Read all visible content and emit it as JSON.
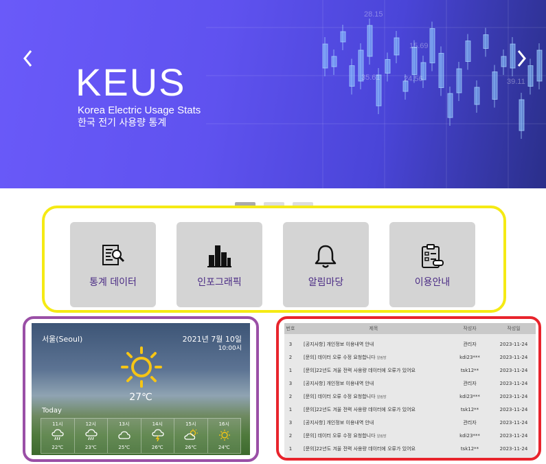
{
  "hero": {
    "title": "KEUS",
    "subtitle_en": "Korea Electric Usage Stats",
    "subtitle_ko": "한국 전기 사용량 통계",
    "bg_numbers": [
      "28.15",
      "24.56",
      "39.11",
      "15.69",
      "35.61"
    ]
  },
  "carousel": {
    "prev_icon": "chevron-left-icon",
    "next_icon": "chevron-right-icon",
    "page_count": 3,
    "active_page": 1
  },
  "quick_menu": {
    "items": [
      {
        "label": "통계 데이터",
        "icon": "document-search-icon"
      },
      {
        "label": "인포그래픽",
        "icon": "bar-chart-icon"
      },
      {
        "label": "알림마당",
        "icon": "bell-icon"
      },
      {
        "label": "이용안내",
        "icon": "clipboard-icon"
      }
    ]
  },
  "weather": {
    "city": "서울(Seoul)",
    "date": "2021년 7월 10일",
    "time": "10:00시",
    "current_temp": "27℃",
    "current_icon": "sun-icon",
    "today_label": "Today",
    "hourly": [
      {
        "hour": "11시",
        "icon": "rain-cloud-icon",
        "temp": "22℃"
      },
      {
        "hour": "12시",
        "icon": "rain-cloud-icon",
        "temp": "23℃"
      },
      {
        "hour": "13시",
        "icon": "cloud-icon",
        "temp": "25℃"
      },
      {
        "hour": "14시",
        "icon": "thunder-cloud-icon",
        "temp": "26℃"
      },
      {
        "hour": "15시",
        "icon": "partly-sunny-icon",
        "temp": "26℃"
      },
      {
        "hour": "16시",
        "icon": "sun-icon",
        "temp": "24℃"
      }
    ]
  },
  "board": {
    "headers": {
      "no": "번호",
      "title": "제목",
      "writer": "작성자",
      "date": "작성일"
    },
    "new_badge": "알림방",
    "rows": [
      {
        "no": "3",
        "title": "[공지사항] 개인정보 이용내역 안내",
        "new": false,
        "writer": "관리자",
        "date": "2023-11-24"
      },
      {
        "no": "2",
        "title": "[문의] 데이터 오류 수정 요청합니다",
        "new": true,
        "writer": "kdi23***",
        "date": "2023-11-24"
      },
      {
        "no": "1",
        "title": "[문의]22년도 겨울 전력 사용량 데이터에 오류가 있어요",
        "new": false,
        "writer": "tsk12**",
        "date": "2023-11-24"
      },
      {
        "no": "3",
        "title": "[공지사항] 개인정보 이용내역 안내",
        "new": false,
        "writer": "관리자",
        "date": "2023-11-24"
      },
      {
        "no": "2",
        "title": "[문의] 데이터 오류 수정 요청합니다",
        "new": true,
        "writer": "kdi23***",
        "date": "2023-11-24"
      },
      {
        "no": "1",
        "title": "[문의]22년도 겨울 전력 사용량 데이터에 오류가 있어요",
        "new": false,
        "writer": "tsk12**",
        "date": "2023-11-24"
      },
      {
        "no": "3",
        "title": "[공지사항] 개인정보 이용내역 안내",
        "new": false,
        "writer": "관리자",
        "date": "2023-11-24"
      },
      {
        "no": "2",
        "title": "[문의] 데이터 오류 수정 요청합니다",
        "new": true,
        "writer": "kdi23***",
        "date": "2023-11-24"
      },
      {
        "no": "1",
        "title": "[문의]22년도 겨울 전력 사용량 데이터에 오류가 있어요",
        "new": false,
        "writer": "tsk12**",
        "date": "2023-11-24"
      }
    ]
  },
  "colors": {
    "quick_frame": "#f5ea14",
    "weather_frame": "#9a4fa6",
    "board_frame": "#e8242c",
    "quick_label": "#4b2c85"
  }
}
